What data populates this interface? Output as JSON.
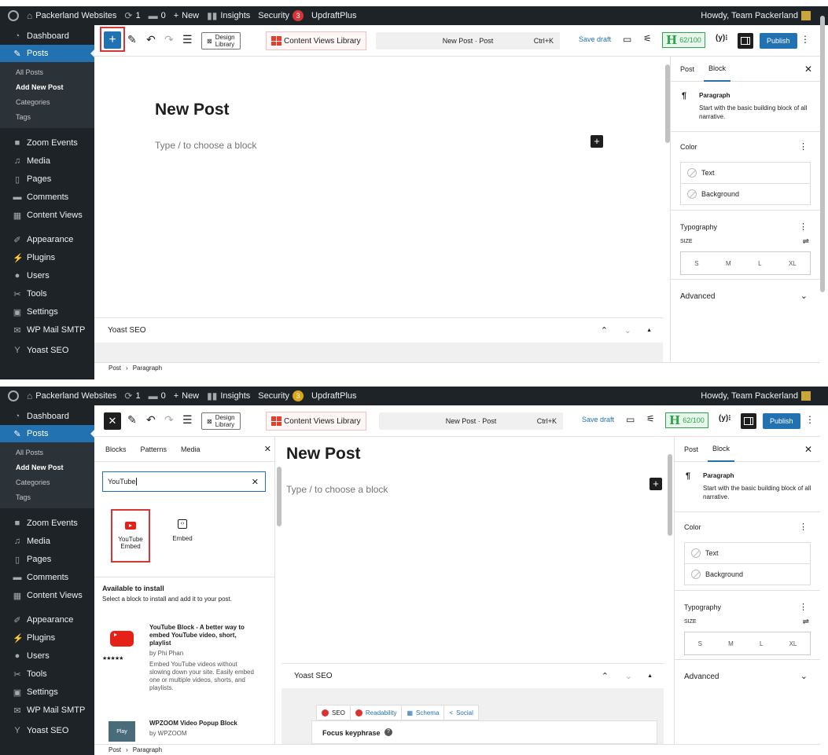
{
  "adminbar": {
    "site": "Packerland Websites",
    "updates": "1",
    "comments": "0",
    "new": "New",
    "insights": "Insights",
    "security": "Security",
    "security_badge": "3",
    "updraft": "UpdraftPlus",
    "howdy": "Howdy, Team Packerland"
  },
  "sidebar": {
    "items": [
      "Dashboard",
      "Posts",
      "Zoom Events",
      "Media",
      "Pages",
      "Comments",
      "Content Views",
      "Appearance",
      "Plugins",
      "Users",
      "Tools",
      "Settings",
      "WP Mail SMTP",
      "Yoast SEO"
    ],
    "sub": [
      "All Posts",
      "Add New Post",
      "Categories",
      "Tags"
    ]
  },
  "toolbar": {
    "design_library_1": "Design",
    "design_library_2": "Library",
    "content_views_library": "Content Views Library",
    "command_title": "New Post · Post",
    "shortcut": "Ctrl+K",
    "save_draft": "Save draft",
    "seo_score": "62/100",
    "publish": "Publish"
  },
  "editor": {
    "title": "New Post",
    "placeholder": "Type / to choose a block"
  },
  "yoast": {
    "title": "Yoast SEO",
    "tabs": [
      "SEO",
      "Readability",
      "Schema",
      "Social"
    ],
    "focus_keyphrase": "Focus keyphrase"
  },
  "footer": {
    "crumb1": "Post",
    "crumb2": "Paragraph"
  },
  "settings": {
    "tab_post": "Post",
    "tab_block": "Block",
    "block_name": "Paragraph",
    "block_desc": "Start with the basic building block of all narrative.",
    "color_heading": "Color",
    "color_text": "Text",
    "color_background": "Background",
    "typography_heading": "Typography",
    "size_label": "SIZE",
    "sizes": [
      "S",
      "M",
      "L",
      "XL"
    ],
    "advanced": "Advanced"
  },
  "inserter": {
    "tabs": [
      "Blocks",
      "Patterns",
      "Media"
    ],
    "search_value": "YouTube",
    "blocks": [
      "YouTube Embed",
      "Embed"
    ],
    "available_heading": "Available to install",
    "available_desc": "Select a block to install and add it to your post.",
    "plugin1_title": "YouTube Block - A better way to embed YouTube video, short, playlist",
    "plugin1_author": "by Phi Phan",
    "plugin1_stars": "★★★★★",
    "plugin1_desc": "Embed YouTube videos without slowing down your site. Easily embed one or multiple videos, shorts, and playlists.",
    "plugin2_title": "WPZOOM Video Popup Block",
    "plugin2_author": "by WPZOOM",
    "plugin2_play": "Play"
  },
  "colors": {
    "admin_dark": "#1d2327",
    "accent": "#2271b1",
    "highlight_red": "#d63638",
    "seo_green": "#2fa44f"
  }
}
